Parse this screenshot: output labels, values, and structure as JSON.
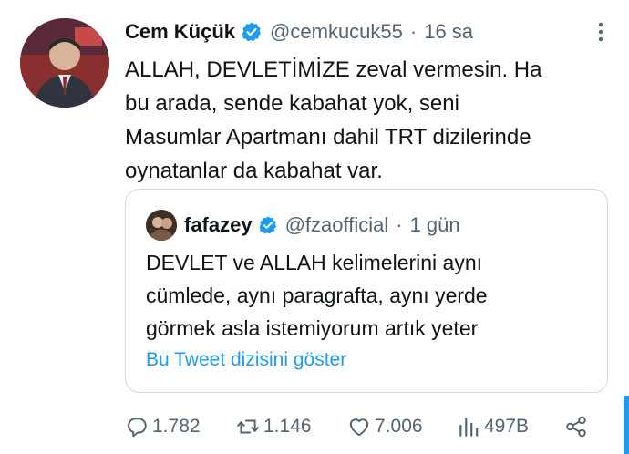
{
  "tweet": {
    "author_name": "Cem Küçük",
    "handle": "@cemkucuk55",
    "separator": "·",
    "time": "16 sa",
    "text": "ALLAH, DEVLETİMİZE zeval vermesin.  Ha\nbu arada, sende kabahat yok, seni\nMasumlar Apartmanı dahil TRT dizilerinde\noynatanlar da kabahat var."
  },
  "quoted": {
    "author_name": "fafazey",
    "handle": "@fzaofficial",
    "separator": "·",
    "time": "1 gün",
    "text": "DEVLET ve ALLAH kelimelerini aynı\ncümlede, aynı paragrafta, aynı yerde\ngörmek asla istemiyorum artık yeter",
    "thread_link": "Bu Tweet dizisini göster"
  },
  "actions": {
    "replies": "1.782",
    "retweets": "1.146",
    "likes": "7.006",
    "views": "497B"
  },
  "icons": {
    "verified": "verified-badge-icon",
    "more": "more-icon",
    "reply": "reply-icon",
    "retweet": "retweet-icon",
    "like": "heart-icon",
    "views": "views-icon",
    "share": "share-icon"
  },
  "colors": {
    "accent": "#1d9bf0",
    "text": "#0f1419",
    "muted": "#536471",
    "border": "#cfd9de"
  }
}
